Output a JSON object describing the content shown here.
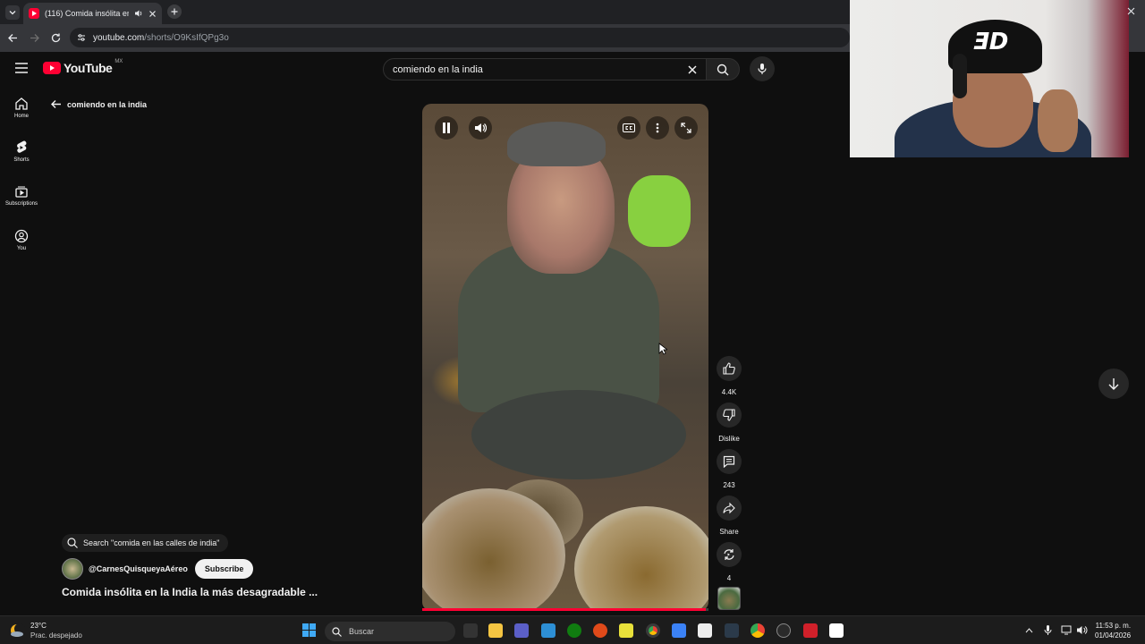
{
  "browser": {
    "tab_title": "(116) Comida insólita en la I",
    "url_host": "youtube.com",
    "url_path": "/shorts/O9KsIfQPg3o"
  },
  "header": {
    "logo_text": "YouTube",
    "region": "MX",
    "search_value": "comiendo en la india"
  },
  "sidebar": {
    "items": [
      {
        "label": "Home",
        "icon": "home-icon"
      },
      {
        "label": "Shorts",
        "icon": "shorts-icon"
      },
      {
        "label": "Subscriptions",
        "icon": "subscriptions-icon"
      },
      {
        "label": "You",
        "icon": "you-icon"
      }
    ]
  },
  "back_link": {
    "label": "comiendo en la india"
  },
  "video": {
    "progress": 0.99
  },
  "actions": {
    "like_count": "4.4K",
    "dislike_label": "Dislike",
    "comment_count": "243",
    "share_label": "Share",
    "remix_count": "4"
  },
  "info": {
    "related_search": "Search \"comida en las calles de india\"",
    "channel": "@CarnesQuisqueyaAéreo",
    "subscribe_label": "Subscribe",
    "title": "Comida insólita en la India la más desagradable ..."
  },
  "taskbar": {
    "weather_temp": "23°C",
    "weather_desc": "Prac. despejado",
    "search_label": "Buscar",
    "time": "11:53 p. m.",
    "date": "01/04/2026"
  },
  "colors": {
    "accent": "#ff0033",
    "background": "#0f0f0f"
  }
}
